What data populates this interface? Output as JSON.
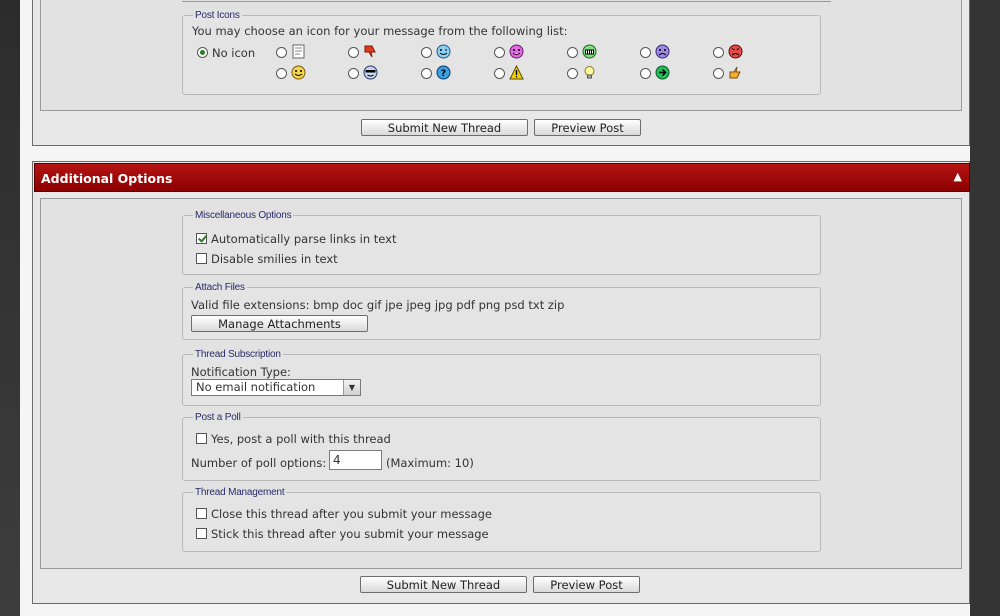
{
  "post_icons": {
    "legend": "Post Icons",
    "intro": "You may choose an icon for your message from the following list:",
    "no_icon_label": "No icon",
    "icons_row1": [
      "note-icon",
      "thumbs-down-icon",
      "wink-icon",
      "grin-icon",
      "cheerful-icon",
      "frown-icon",
      "mad-icon"
    ],
    "icons_row2": [
      "smile-icon",
      "cool-icon",
      "question-icon",
      "warning-icon",
      "lightbulb-icon",
      "arrow-icon",
      "thumbs-up-icon"
    ]
  },
  "buttons": {
    "submit": "Submit New Thread",
    "preview": "Preview Post"
  },
  "additional_options": {
    "title": "Additional Options",
    "collapse_icon": "collapse-icon",
    "header_color": "#a80000",
    "misc": {
      "legend": "Miscellaneous Options",
      "parse_links": "Automatically parse links in text",
      "parse_links_checked": true,
      "disable_smilies": "Disable smilies in text",
      "disable_smilies_checked": false
    },
    "attach": {
      "legend": "Attach Files",
      "extensions": "Valid file extensions: bmp doc gif jpe jpeg jpg pdf png psd txt zip",
      "manage_button": "Manage Attachments"
    },
    "subscription": {
      "legend": "Thread Subscription",
      "label": "Notification Type:",
      "selected": "No email notification"
    },
    "poll": {
      "legend": "Post a Poll",
      "checkbox_label": "Yes, post a poll with this thread",
      "options_label": "Number of poll options:",
      "options_value": "4",
      "maximum": "(Maximum: 10)"
    },
    "management": {
      "legend": "Thread Management",
      "close_label": "Close this thread after you submit your message",
      "stick_label": "Stick this thread after you submit your message"
    }
  }
}
